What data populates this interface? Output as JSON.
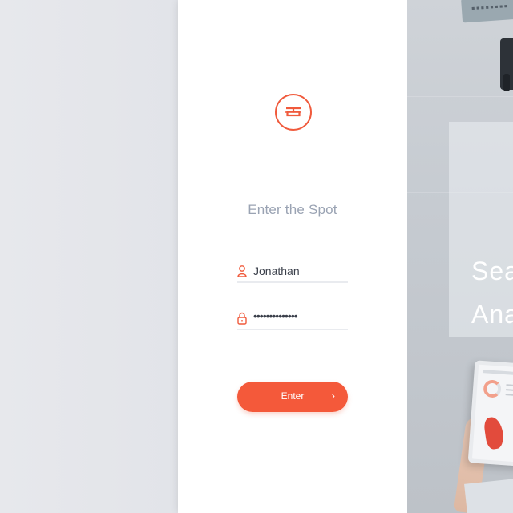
{
  "login": {
    "heading": "Enter the Spot",
    "username_value": "Jonathan",
    "password_value": "••••••••••••••",
    "submit_label": "Enter",
    "submit_arrow": "›"
  },
  "hero": {
    "line1": "Sear",
    "line2": "Ana"
  },
  "icons": {
    "logo": "brand-logo-icon",
    "user": "user-icon",
    "lock": "lock-icon",
    "arrow": "chevron-right-icon"
  },
  "colors": {
    "accent": "#f4593a",
    "heading_text": "#9aa3b3",
    "input_text": "#3a3f4a",
    "card_bg": "#ffffff",
    "page_bg": "#e5e7ec"
  }
}
